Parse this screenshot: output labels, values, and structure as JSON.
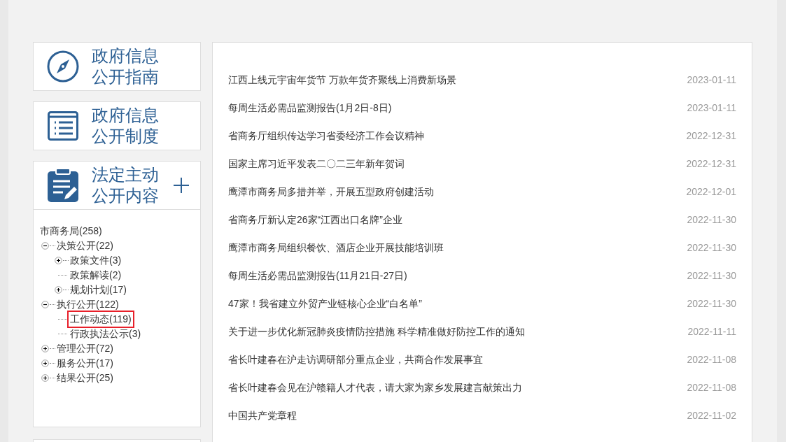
{
  "nav_cards": [
    {
      "kind": "compass",
      "line1": "政府信息",
      "line2": "公开指南",
      "expandable": false
    },
    {
      "kind": "list",
      "line1": "政府信息",
      "line2": "公开制度",
      "expandable": false
    },
    {
      "kind": "clipboard",
      "line1": "法定主动",
      "line2": "公开内容",
      "expandable": true
    }
  ],
  "tree": {
    "label": "市商务局(258)",
    "selected": false,
    "children": [
      {
        "label": "决策公开(22)",
        "expanded": true,
        "selected": false,
        "children": [
          {
            "label": "政策文件(3)",
            "expanded": false,
            "selected": false
          },
          {
            "label": "政策解读(2)",
            "selected": false
          },
          {
            "label": "规划计划(17)",
            "expanded": false,
            "selected": false
          }
        ]
      },
      {
        "label": "执行公开(122)",
        "expanded": true,
        "selected": false,
        "children": [
          {
            "label": "工作动态(119)",
            "selected": true
          },
          {
            "label": "行政执法公示(3)",
            "selected": false
          }
        ]
      },
      {
        "label": "管理公开(72)",
        "expanded": false,
        "selected": false
      },
      {
        "label": "服务公开(17)",
        "expanded": false,
        "selected": false
      },
      {
        "label": "结果公开(25)",
        "expanded": false,
        "selected": false
      }
    ]
  },
  "articles": [
    {
      "title": "江西上线元宇宙年货节 万款年货齐聚线上消费新场景",
      "date": "2023-01-11"
    },
    {
      "title": "每周生活必需品监测报告(1月2日-8日)",
      "date": "2023-01-11"
    },
    {
      "title": "省商务厅组织传达学习省委经济工作会议精神",
      "date": "2022-12-31"
    },
    {
      "title": "国家主席习近平发表二〇二三年新年贺词",
      "date": "2022-12-31"
    },
    {
      "title": "鹰潭市商务局多措并举，开展五型政府创建活动",
      "date": "2022-12-01"
    },
    {
      "title": "省商务厅新认定26家“江西出口名牌”企业",
      "date": "2022-11-30"
    },
    {
      "title": "鹰潭市商务局组织餐饮、酒店企业开展技能培训班",
      "date": "2022-11-30"
    },
    {
      "title": "每周生活必需品监测报告(11月21日-27日)",
      "date": "2022-11-30"
    },
    {
      "title": "47家！我省建立外贸产业链核心企业“白名单”",
      "date": "2022-11-30"
    },
    {
      "title": "关于进一步优化新冠肺炎疫情防控措施 科学精准做好防控工作的通知",
      "date": "2022-11-11"
    },
    {
      "title": "省长叶建春在沪走访调研部分重点企业，共商合作发展事宜",
      "date": "2022-11-08"
    },
    {
      "title": "省长叶建春会见在沪赣籍人才代表，请大家为家乡发展建言献策出力",
      "date": "2022-11-08"
    },
    {
      "title": "中国共产党章程",
      "date": "2022-11-02"
    }
  ]
}
